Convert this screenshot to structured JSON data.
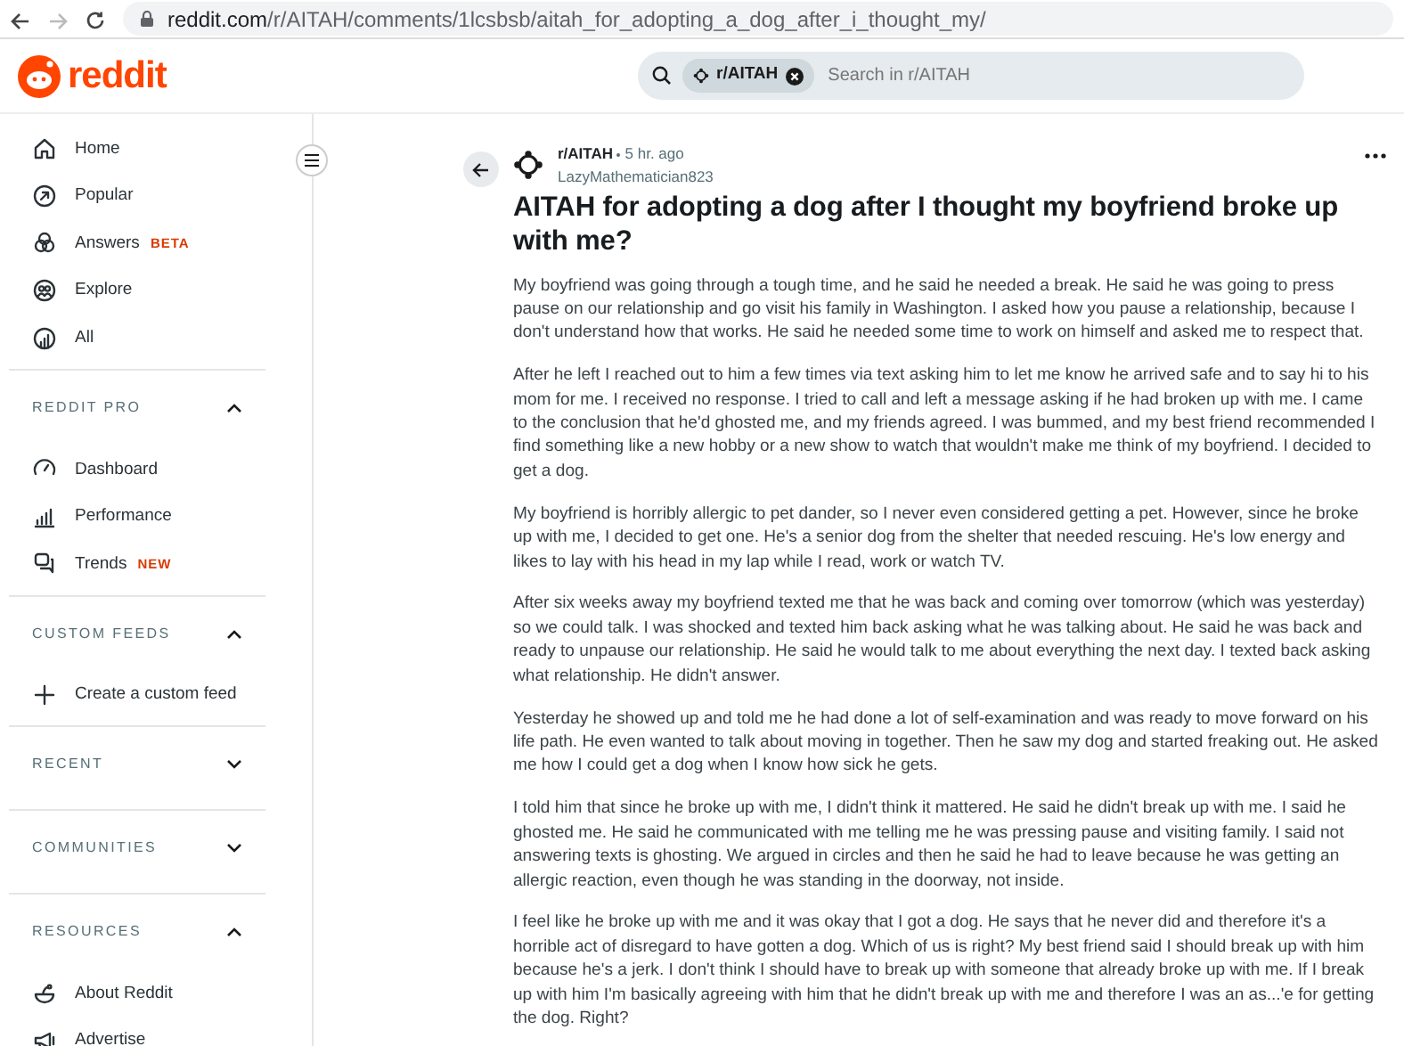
{
  "browser": {
    "url_host": "reddit.com",
    "url_path": "/r/AITAH/comments/1lcsbsb/aitah_for_adopting_a_dog_after_i_thought_my/"
  },
  "header": {
    "logo_text": "reddit",
    "search": {
      "chip": "r/AITAH",
      "placeholder": "Search in r/AITAH"
    }
  },
  "sidebar": {
    "items": [
      {
        "label": "Home"
      },
      {
        "label": "Popular"
      },
      {
        "label": "Answers",
        "badge": "BETA"
      },
      {
        "label": "Explore"
      },
      {
        "label": "All"
      }
    ],
    "sections": [
      {
        "title": "REDDIT PRO",
        "expanded": true,
        "items": [
          {
            "label": "Dashboard"
          },
          {
            "label": "Performance"
          },
          {
            "label": "Trends",
            "badge": "NEW"
          }
        ]
      },
      {
        "title": "CUSTOM FEEDS",
        "expanded": true,
        "items": [
          {
            "label": "Create a custom feed"
          }
        ]
      },
      {
        "title": "RECENT",
        "expanded": false
      },
      {
        "title": "COMMUNITIES",
        "expanded": false
      },
      {
        "title": "RESOURCES",
        "expanded": true,
        "items": [
          {
            "label": "About Reddit"
          },
          {
            "label": "Advertise"
          }
        ]
      }
    ]
  },
  "post": {
    "subreddit": "r/AITAH",
    "time": "5 hr. ago",
    "author": "LazyMathematician823",
    "title": "AITAH for adopting a dog after I thought my boyfriend broke up with me?",
    "paragraphs": [
      "My boyfriend was going through a tough time, and he said he needed a break. He said he was going to press pause on our relationship and go visit his family in Washington. I asked how you pause a relationship, because I don't understand how that works. He said he needed some time to work on himself and asked me to respect that.",
      "After he left I reached out to him a few times via text asking him to let me know he arrived safe and to say hi to his mom for me. I received no response. I tried to call and left a message asking if he had broken up with me. I came to the conclusion that he'd ghosted me, and my friends agreed. I was bummed, and my best friend recommended I find something like a new hobby or a new show to watch that wouldn't make me think of my boyfriend. I decided to get a dog.",
      "My boyfriend is horribly allergic to pet dander, so I never even considered getting a pet. However, since he broke up with me, I decided to get one. He's a senior dog from the shelter that needed rescuing. He's low energy and likes to lay with his head in my lap while I read, work or watch TV.",
      "After six weeks away my boyfriend texted me that he was back and coming over tomorrow (which was yesterday) so we could talk. I was shocked and texted him back asking what he was talking about. He said he was back and ready to unpause our relationship. He said he would talk to me about everything the next day. I texted back asking what relationship. He didn't answer.",
      "Yesterday he showed up and told me he had done a lot of self-examination and was ready to move forward on his life path. He even wanted to talk about moving in together. Then he saw my dog and started freaking out. He asked me how I could get a dog when I know how sick he gets.",
      "I told him that since he broke up with me, I didn't think it mattered. He said he didn't break up with me. I said he ghosted me. He said he communicated with me telling me he was pressing pause and visiting family. I said not answering texts is ghosting. We argued in circles and then he said he had to leave because he was getting an allergic reaction, even though he was standing in the doorway, not inside.",
      "I feel like he broke up with me and it was okay that I got a dog. He says that he never did and therefore it's a horrible act of disregard to have gotten a dog. Which of us is right? My best friend said I should break up with him because he's a jerk. I don't think I should have to break up with someone that already broke up with me. If I break up with him I'm basically agreeing with him that he didn't break up with me and therefore I was an as...'e for getting the dog. Right?"
    ]
  }
}
